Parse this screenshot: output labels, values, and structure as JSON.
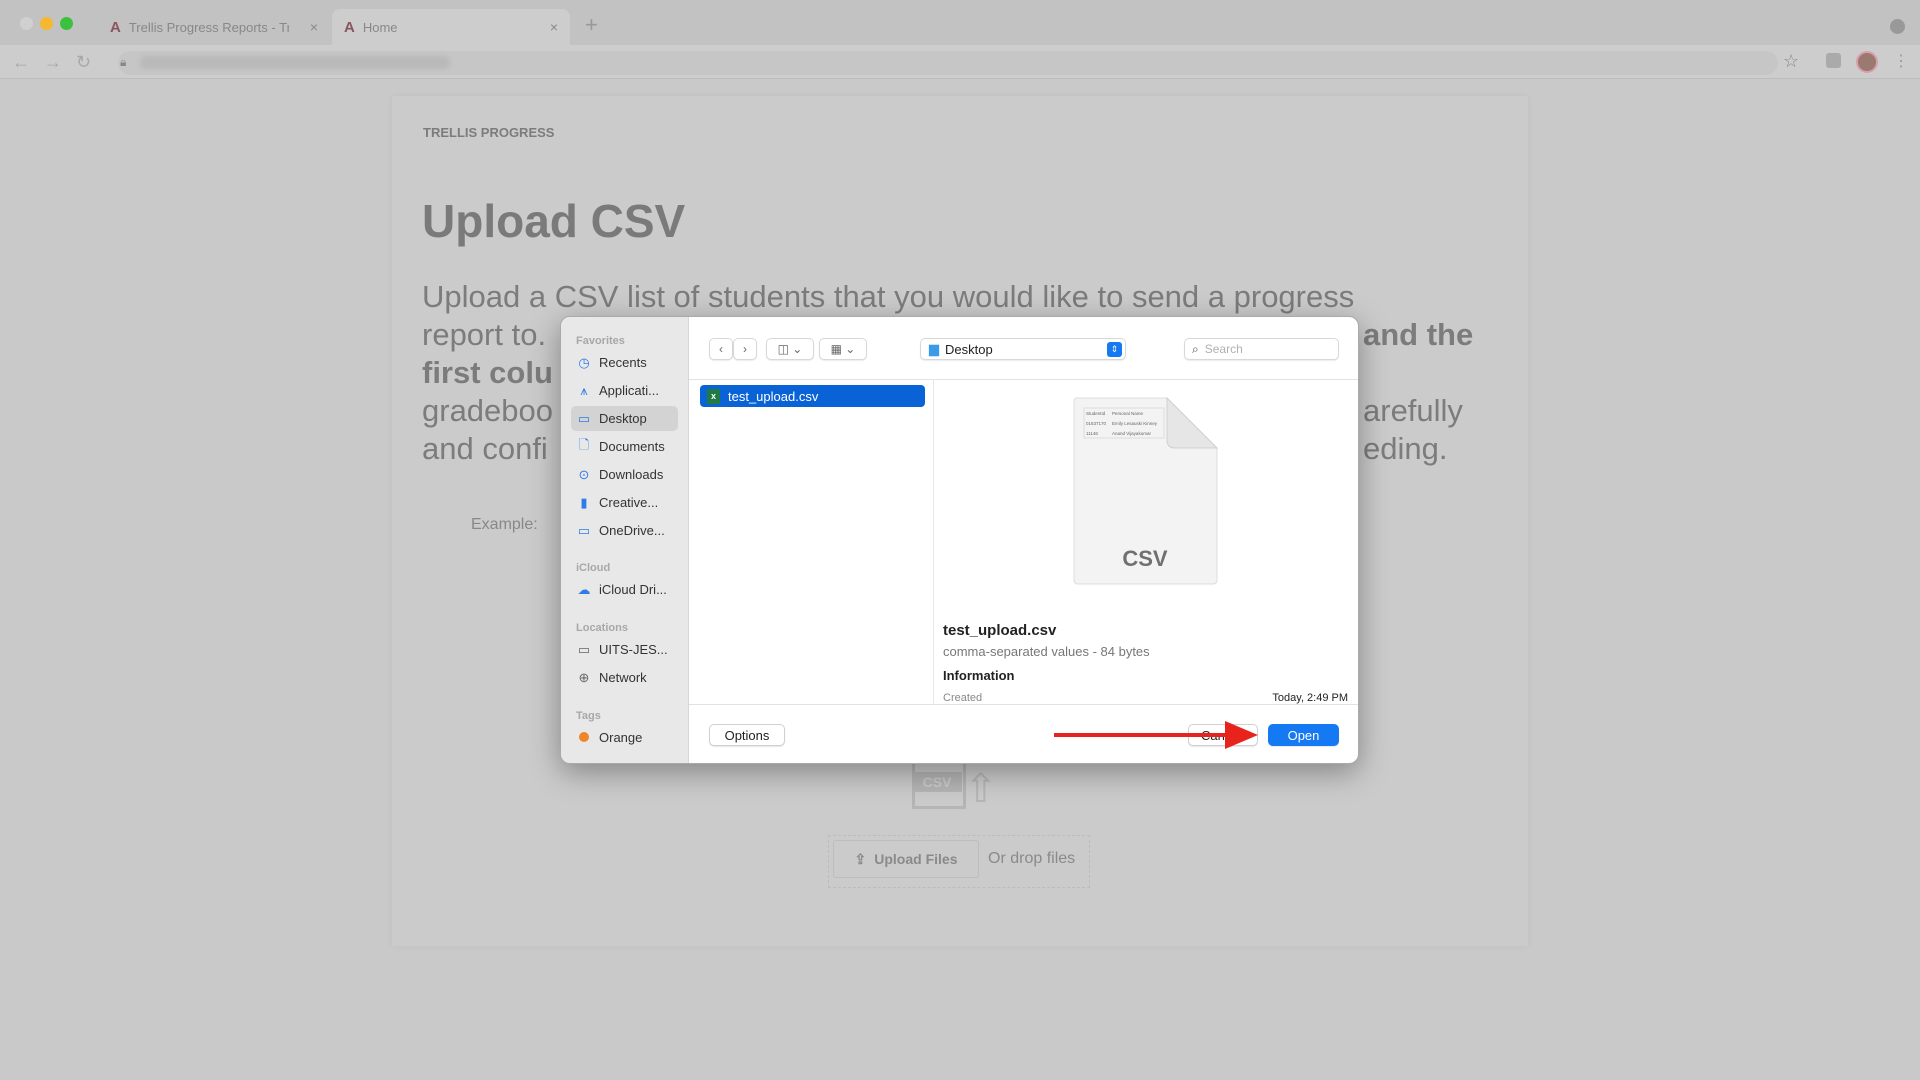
{
  "browser": {
    "tabs": [
      {
        "title": "Trellis Progress Reports - Trelli",
        "active": false
      },
      {
        "title": "Home",
        "active": true
      }
    ],
    "new_tab": "+",
    "close": "×"
  },
  "page": {
    "brand": "TRELLIS PROGRESS",
    "title": "Upload CSV",
    "paragraph": {
      "line1": "Upload a CSV list of students that you would like to send a progress",
      "line2_left": "report to.",
      "line2_right": "and the",
      "line3_left": "first colu",
      "line4_left": "gradeboo",
      "line4_right": "arefully",
      "line5_left": "and confi",
      "line5_right": "eding."
    },
    "example_label": "Example:",
    "upload_icon_text": "CSV",
    "upload_button": "Upload Files",
    "drop_text": "Or drop files"
  },
  "dialog": {
    "sidebar": [
      {
        "heading": "Favorites",
        "items": [
          {
            "label": "Recents",
            "icon": "clock-icon"
          },
          {
            "label": "Applicati...",
            "icon": "applications-icon"
          },
          {
            "label": "Desktop",
            "icon": "desktop-icon",
            "selected": true
          },
          {
            "label": "Documents",
            "icon": "document-icon"
          },
          {
            "label": "Downloads",
            "icon": "download-icon"
          },
          {
            "label": "Creative...",
            "icon": "file-icon"
          },
          {
            "label": "OneDrive...",
            "icon": "folder-icon"
          }
        ]
      },
      {
        "heading": "iCloud",
        "items": [
          {
            "label": "iCloud Dri...",
            "icon": "cloud-icon"
          }
        ]
      },
      {
        "heading": "Locations",
        "items": [
          {
            "label": "UITS-JES...",
            "icon": "laptop-icon"
          },
          {
            "label": "Network",
            "icon": "globe-icon"
          }
        ]
      },
      {
        "heading": "Tags",
        "items": [
          {
            "label": "Orange",
            "icon": "orange-tag-icon"
          }
        ]
      }
    ],
    "location": "Desktop",
    "search_placeholder": "Search",
    "files": [
      {
        "name": "test_upload.csv",
        "selected": true
      }
    ],
    "preview": {
      "name": "test_upload.csv",
      "kind": "comma-separated values - 84 bytes",
      "info_heading": "Information",
      "created_label": "Created",
      "created_value": "Today, 2:49 PM",
      "icon_label": "CSV",
      "thumb_rows": [
        [
          "StudentId",
          "Personal Name"
        ],
        [
          "01637170",
          "Emily Lesauski Kinney"
        ],
        [
          "11146",
          "Anand Vijayakumar"
        ]
      ]
    },
    "options": "Options",
    "cancel": "Canc",
    "open": "Open"
  },
  "colors": {
    "accent": "#1479f2",
    "selection": "#0a63d6",
    "annotation_arrow": "#e8231c",
    "tag_orange": "#f0862a"
  }
}
